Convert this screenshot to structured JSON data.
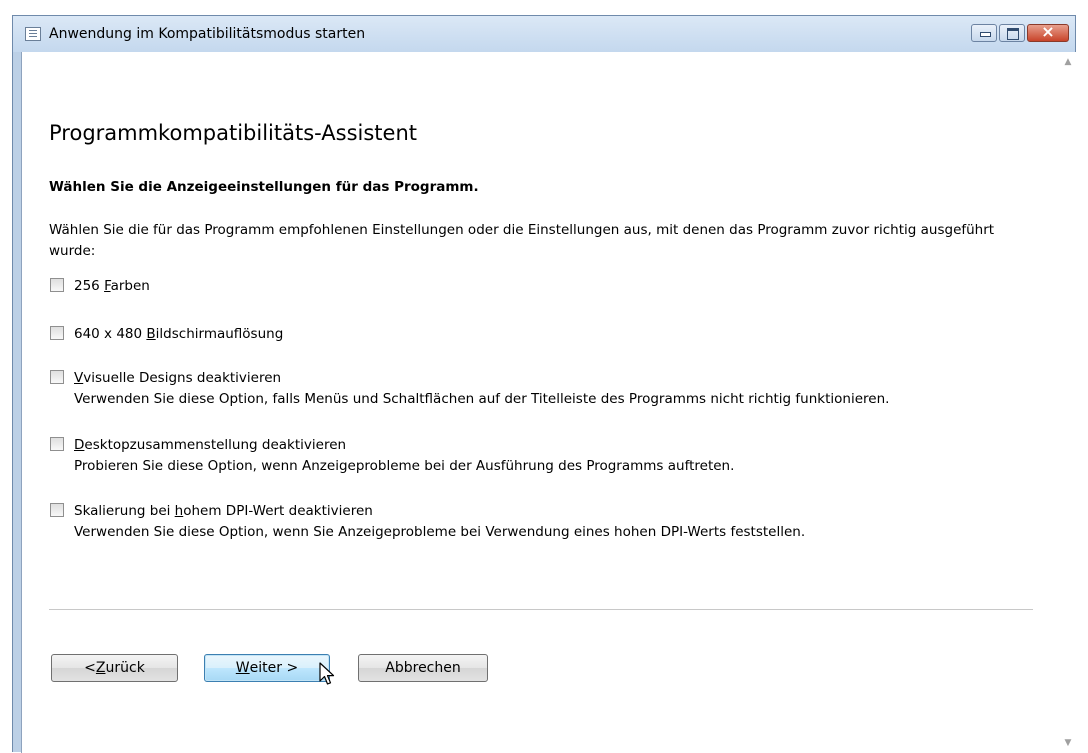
{
  "window": {
    "title": "Anwendung im Kompatibilitätsmodus starten",
    "controls": [
      "minimize-icon",
      "maximize-icon",
      "close-icon"
    ]
  },
  "wizard": {
    "heading": "Programmkompatibilitäts-Assistent",
    "subheading": "Wählen Sie die Anzeigeeinstellungen für das Programm.",
    "intro": "Wählen Sie die für das Programm empfohlenen Einstellungen oder die Einstellungen aus, mit denen das Programm zuvor richtig ausgeführt wurde:"
  },
  "options": [
    {
      "label_pre": "256 ",
      "label_key": "F",
      "label_post": "arben",
      "description": "",
      "checked": false
    },
    {
      "label_pre": "640 x 480 ",
      "label_key": "B",
      "label_post": "ildschirmauflösung",
      "description": "",
      "checked": false
    },
    {
      "label_pre": "",
      "label_key": "V",
      "label_post": "visuelle Designs deaktivieren",
      "description": "Verwenden Sie diese Option, falls Menüs und Schaltflächen auf der Titelleiste des Programms nicht richtig funktionieren.",
      "checked": false
    },
    {
      "label_pre": "",
      "label_key": "D",
      "label_post": "esktopzusammenstellung deaktivieren",
      "description": "Probieren Sie diese Option, wenn Anzeigeprobleme bei der Ausführung des Programms auftreten.",
      "checked": false
    },
    {
      "label_pre": "Skalierung bei ",
      "label_key": "h",
      "label_post": "ohem DPI-Wert deaktivieren",
      "description": "Verwenden Sie diese Option, wenn Sie Anzeigeprobleme bei Verwendung eines hohen DPI-Werts feststellen.",
      "checked": false
    }
  ],
  "buttons": {
    "back_pre": "< ",
    "back_key": "Z",
    "back_post": "urück",
    "next_key": "W",
    "next_post": "eiter >",
    "cancel": "Abbrechen"
  }
}
